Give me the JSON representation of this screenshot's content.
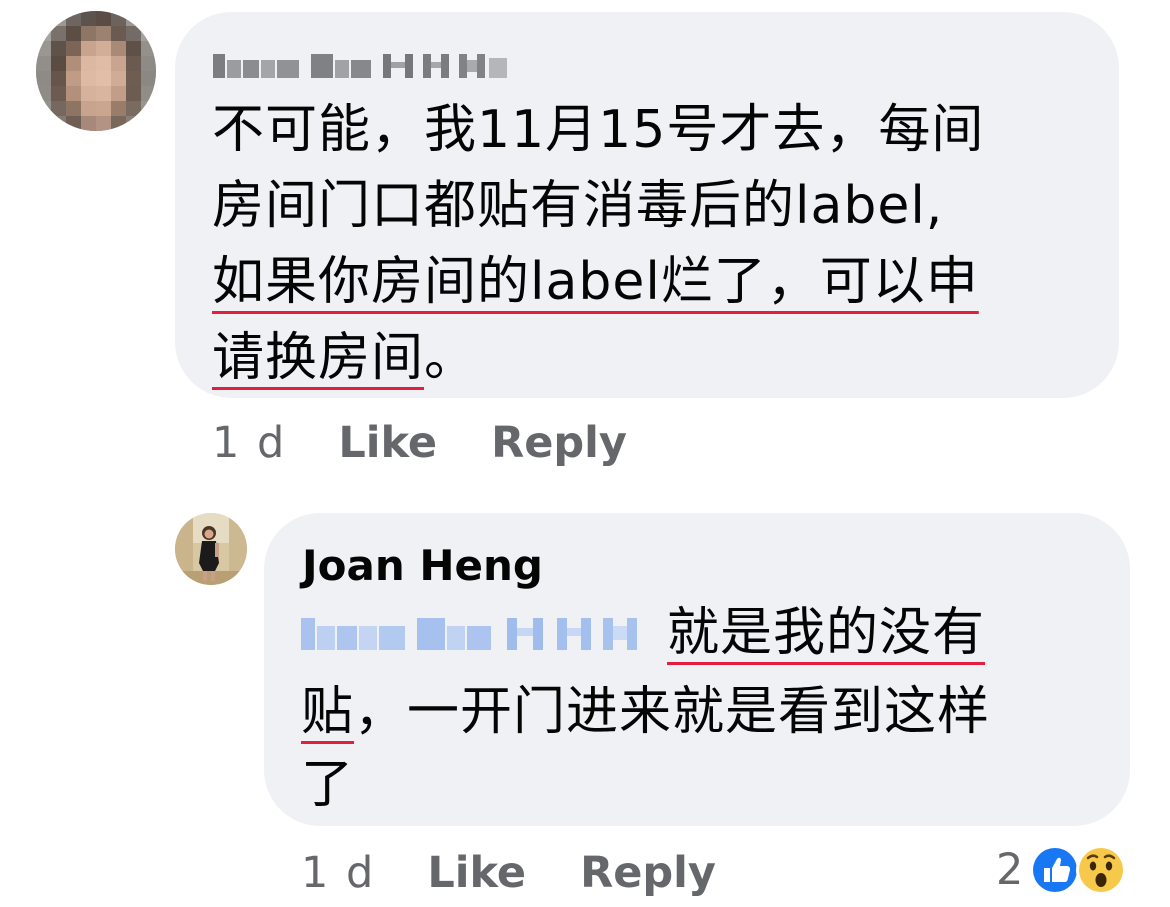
{
  "comments": [
    {
      "text_line1": "不可能，我11月15号才去，每间",
      "text_line2": "房间门口都贴有消毒后的label,",
      "text_line3_underlined": "如果你房间的label烂了，可以申",
      "text_line4_underlined": "请换房间",
      "text_line4_tail": "。",
      "time": "1 d",
      "like_label": "Like",
      "reply_label": "Reply"
    },
    {
      "author": "Joan Heng",
      "text_line1_underlined": "就是我的没有",
      "text_line2_underlined": "贴",
      "text_line2_tail": "，一开门进来就是看到这样",
      "text_line3": "了",
      "time": "1 d",
      "like_label": "Like",
      "reply_label": "Reply",
      "reactions": {
        "count": "2",
        "icons": [
          "like-reaction-icon",
          "wow-reaction-icon"
        ]
      }
    }
  ],
  "colors": {
    "bubble": "#eff1f5",
    "meta_text": "#65676b",
    "underline": "#e41e3f",
    "mention_blue": "#1877f2",
    "like_blue": "#1877f2",
    "wow_yellow": "#f7c94b"
  }
}
